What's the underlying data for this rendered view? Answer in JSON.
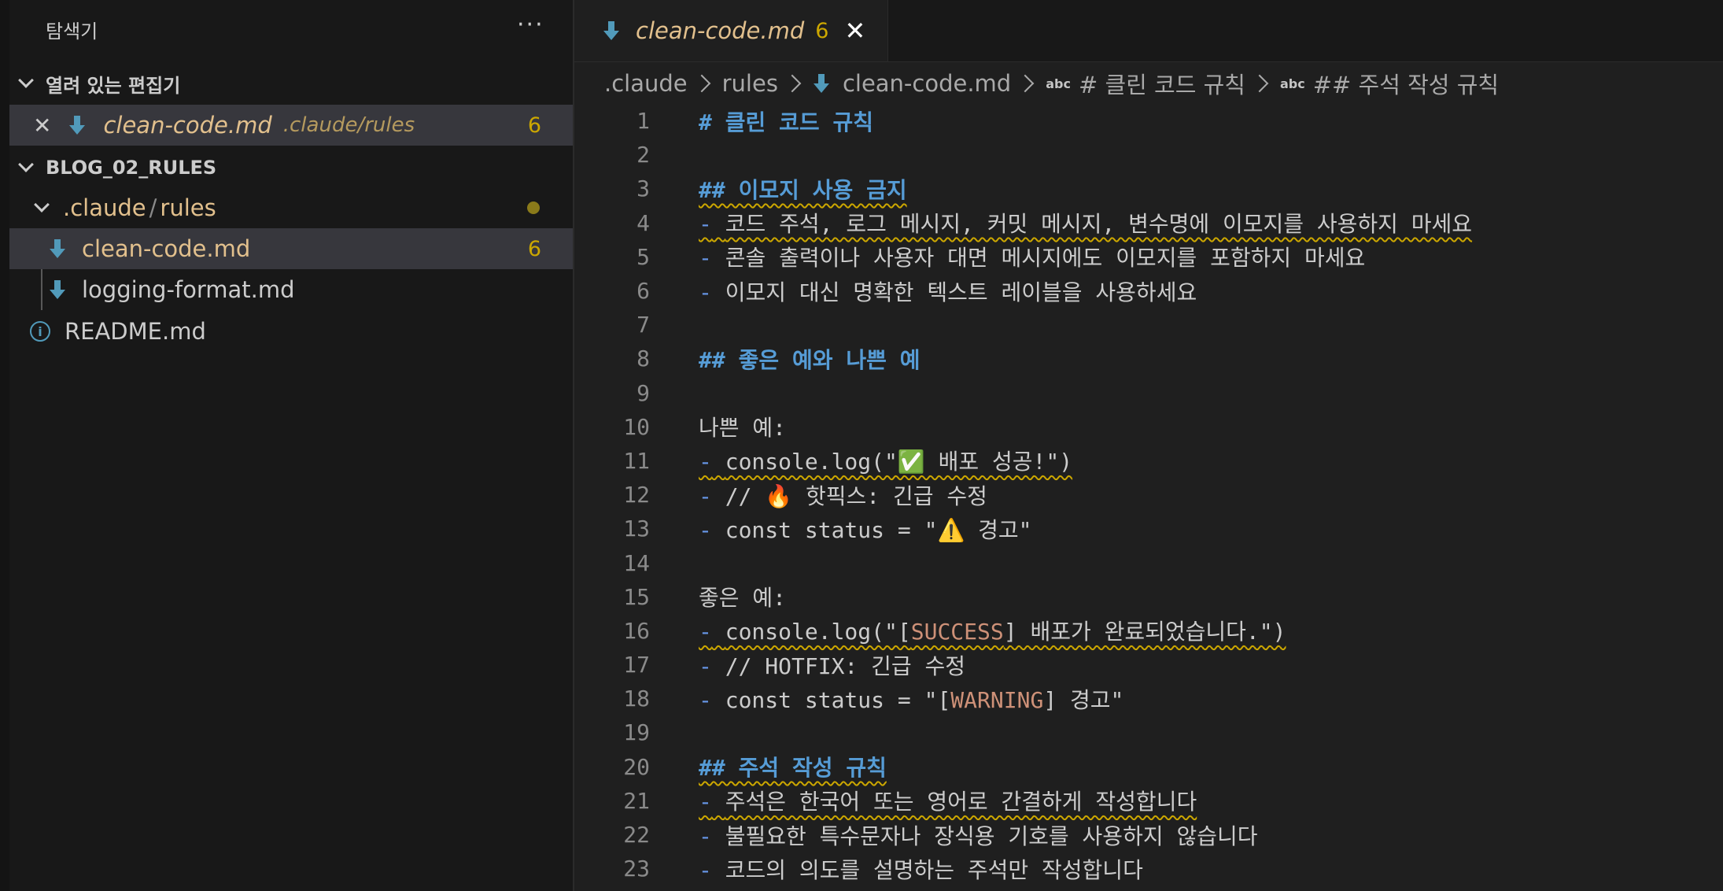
{
  "explorer": {
    "title": "탐색기",
    "more": "···",
    "open_editors": {
      "label": "열려 있는 편집기",
      "items": [
        {
          "name": "clean-code.md",
          "path": ".claude/rules",
          "count": "6"
        }
      ]
    },
    "workspace": {
      "label": "BLOG_02_RULES",
      "folder": {
        "part1": ".claude",
        "sep": "/",
        "part2": "rules"
      },
      "files": [
        {
          "name": "clean-code.md",
          "count": "6"
        },
        {
          "name": "logging-format.md"
        }
      ],
      "root_files": [
        {
          "name": "README.md"
        }
      ]
    }
  },
  "tab": {
    "label": "clean-code.md",
    "count": "6",
    "close": "✕"
  },
  "breadcrumb": {
    "items": [
      ".claude",
      "rules",
      "clean-code.md",
      "# 클린 코드 규칙",
      "## 주석 작성 규칙"
    ],
    "abc": "abc"
  },
  "editor": {
    "lines": [
      {
        "n": "1",
        "t": "# 클린 코드 규칙"
      },
      {
        "n": "2",
        "t": ""
      },
      {
        "n": "3",
        "t": "## 이모지 사용 금지"
      },
      {
        "n": "4",
        "t": "코드 주석, 로그 메시지, 커밋 메시지, 변수명에 이모지를 사용하지 마세요"
      },
      {
        "n": "5",
        "t": "콘솔 출력이나 사용자 대면 메시지에도 이모지를 포함하지 마세요"
      },
      {
        "n": "6",
        "t": "이모지 대신 명확한 텍스트 레이블을 사용하세요"
      },
      {
        "n": "7",
        "t": ""
      },
      {
        "n": "8",
        "t": "## 좋은 예와 나쁜 예"
      },
      {
        "n": "9",
        "t": ""
      },
      {
        "n": "10",
        "t": "나쁜 예:"
      },
      {
        "n": "11",
        "t": "console.log(\"✅ 배포 성공!\")"
      },
      {
        "n": "12",
        "t": "// 🔥 핫픽스: 긴급 수정"
      },
      {
        "n": "13",
        "t": "const status = \"⚠️ 경고\""
      },
      {
        "n": "14",
        "t": ""
      },
      {
        "n": "15",
        "t": "좋은 예:"
      },
      {
        "n": "16",
        "a": "console.log(\"[",
        "b": "SUCCESS",
        "c": "] 배포가 완료되었습니다.\")"
      },
      {
        "n": "17",
        "t": "// HOTFIX: 긴급 수정"
      },
      {
        "n": "18",
        "a": "const status = \"[",
        "b": "WARNING",
        "c": "] 경고\""
      },
      {
        "n": "19",
        "t": ""
      },
      {
        "n": "20",
        "t": "## 주석 작성 규칙"
      },
      {
        "n": "21",
        "t": "주석은 한국어 또는 영어로 간결하게 작성합니다"
      },
      {
        "n": "22",
        "t": "불필요한 특수문자나 장식용 기호를 사용하지 않습니다"
      },
      {
        "n": "23",
        "t": "코드의 의도를 설명하는 주석만 작성합니다"
      }
    ],
    "bullet": "-"
  }
}
